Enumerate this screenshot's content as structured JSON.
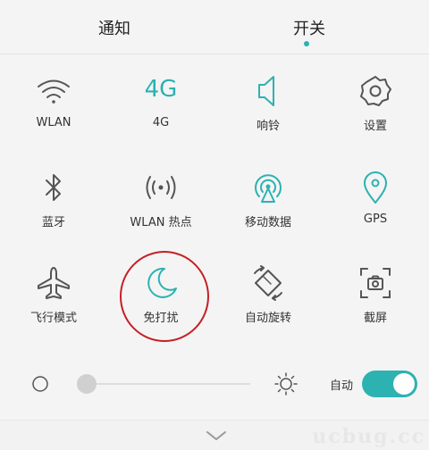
{
  "tabs": {
    "notify": "通知",
    "switches": "开关",
    "active": "开关"
  },
  "accent_color": "#2cb2b1",
  "toggles": [
    {
      "icon": "wifi-icon",
      "label": "WLAN",
      "active": false
    },
    {
      "icon": "4g-icon",
      "icon_text": "4G",
      "label": "4G",
      "active": true
    },
    {
      "icon": "speaker-icon",
      "label": "响铃",
      "active": true
    },
    {
      "icon": "gear-icon",
      "label": "设置",
      "active": false
    },
    {
      "icon": "bluetooth-icon",
      "label": "蓝牙",
      "active": false
    },
    {
      "icon": "hotspot-icon",
      "label": "WLAN 热点",
      "active": false
    },
    {
      "icon": "mobile-data-icon",
      "label": "移动数据",
      "active": true
    },
    {
      "icon": "location-pin-icon",
      "label": "GPS",
      "active": true
    },
    {
      "icon": "airplane-icon",
      "label": "飞行模式",
      "active": false
    },
    {
      "icon": "moon-icon",
      "label": "免打扰",
      "active": true
    },
    {
      "icon": "rotate-icon",
      "label": "自动旋转",
      "active": false
    },
    {
      "icon": "screenshot-icon",
      "label": "截屏",
      "active": false
    }
  ],
  "brightness": {
    "level": 0.0,
    "auto_label": "自动",
    "auto_on": true
  },
  "watermark": "ucbug.cc"
}
